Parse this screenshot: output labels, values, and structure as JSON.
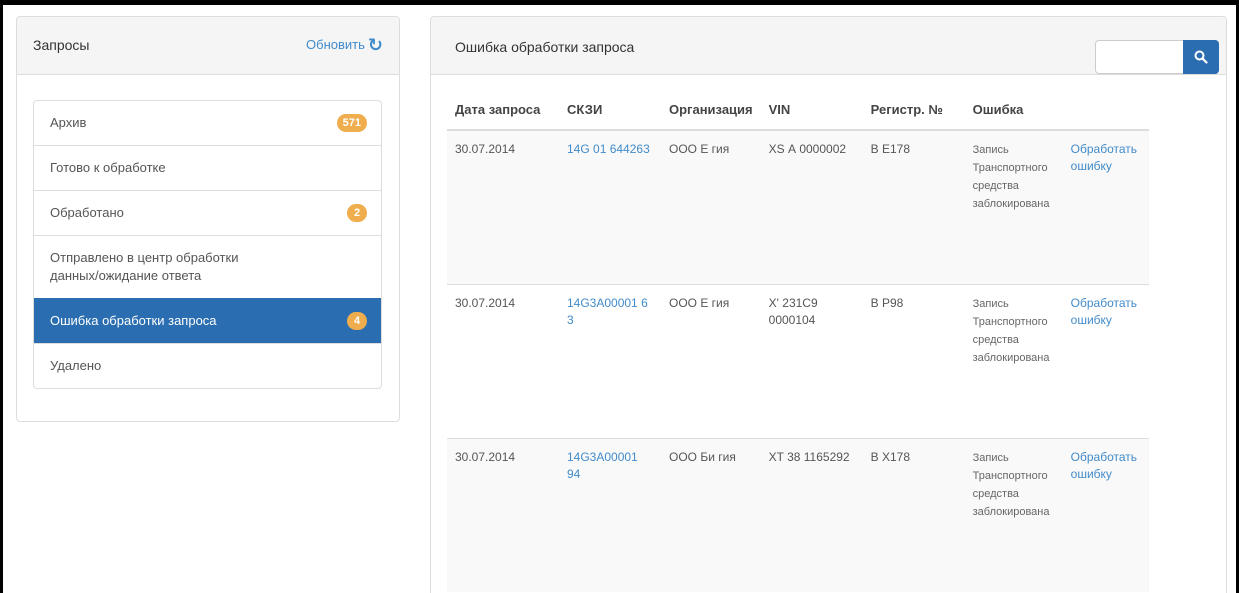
{
  "left": {
    "title": "Запросы",
    "refresh_label": "Обновить",
    "items": [
      {
        "label": "Архив",
        "badge": "571"
      },
      {
        "label": "Готово к обработке",
        "badge": ""
      },
      {
        "label": "Обработано",
        "badge": "2"
      },
      {
        "label": "Отправлено в центр обработки данных/ожидание ответа",
        "badge": ""
      },
      {
        "label": "Ошибка обработки запроса",
        "badge": "4",
        "active": true
      },
      {
        "label": "Удалено",
        "badge": ""
      }
    ]
  },
  "right": {
    "title": "Ошибка обработки запроса",
    "search": {
      "value": "",
      "placeholder": ""
    },
    "columns": [
      "Дата запроса",
      "СКЗИ",
      "Организация",
      "VIN",
      "Регистр. №",
      "Ошибка",
      ""
    ],
    "rows": [
      {
        "date": "30.07.2014",
        "skzi": "14G 01 644263",
        "org": "ООО Е гия",
        "vin": "XS А 0000002",
        "reg": "В Е178",
        "error": "Запись Транспортного средства заблокирована",
        "action": "Обработать ошибку"
      },
      {
        "date": "30.07.2014",
        "skzi": "14G3A00001 6 3",
        "org": "ООО Е гия",
        "vin": "X' 231C9 0000104",
        "reg": "В Р98",
        "error": "Запись Транспортного средства заблокирована",
        "action": "Обработать ошибку"
      },
      {
        "date": "30.07.2014",
        "skzi": "14G3A00001 94",
        "org": "ООО Би гия",
        "vin": "XT 38 1165292",
        "reg": "В Х178",
        "error": "Запись Транспортного средства заблокирована",
        "action": "Обработать ошибку"
      }
    ]
  },
  "colors": {
    "accent": "#2a6db0",
    "link": "#428bca",
    "badge": "#f0ad4e"
  }
}
